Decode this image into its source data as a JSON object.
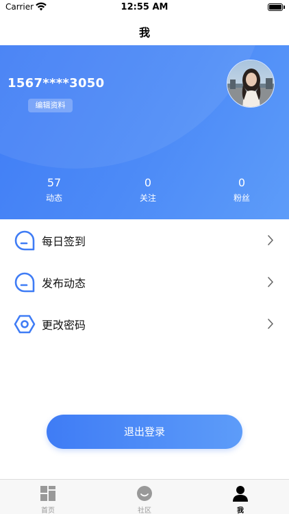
{
  "status_bar": {
    "carrier": "Carrier",
    "time": "12:55 AM"
  },
  "nav": {
    "title": "我"
  },
  "profile": {
    "username": "1567****3050",
    "edit_label": "编辑资料",
    "stats": [
      {
        "value": "57",
        "label": "动态"
      },
      {
        "value": "0",
        "label": "关注"
      },
      {
        "value": "0",
        "label": "粉丝"
      }
    ]
  },
  "menu": [
    {
      "label": "每日签到",
      "icon": "chat-bubble-icon"
    },
    {
      "label": "发布动态",
      "icon": "chat-bubble-icon"
    },
    {
      "label": "更改密码",
      "icon": "hexagon-nut-icon"
    }
  ],
  "logout": {
    "label": "退出登录"
  },
  "tabs": [
    {
      "label": "首页",
      "icon": "grid-icon",
      "active": false
    },
    {
      "label": "社区",
      "icon": "smiley-icon",
      "active": false
    },
    {
      "label": "我",
      "icon": "person-icon",
      "active": true
    }
  ],
  "colors": {
    "accent": "#3f7cf5",
    "accent_light": "#5d9cf9"
  }
}
